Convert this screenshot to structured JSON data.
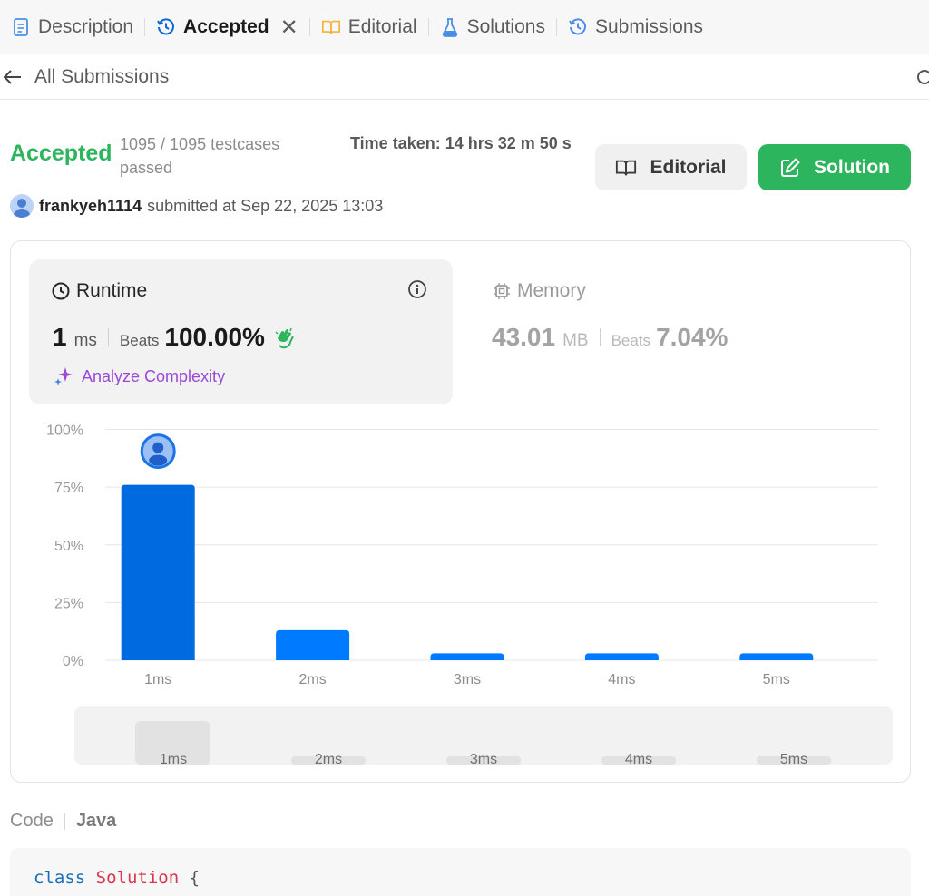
{
  "tabs": [
    {
      "label": "Description",
      "icon": "description-icon"
    },
    {
      "label": "Accepted",
      "icon": "history-icon",
      "active": true
    },
    {
      "label": "Editorial",
      "icon": "book-icon"
    },
    {
      "label": "Solutions",
      "icon": "flask-icon"
    },
    {
      "label": "Submissions",
      "icon": "history-icon"
    }
  ],
  "back": {
    "label": "All Submissions"
  },
  "result": {
    "status": "Accepted",
    "testcases": "1095 / 1095 testcases passed",
    "time_taken": "Time taken: 14 hrs 32 m 50 s",
    "user": "frankyeh1114",
    "submitted_at": "submitted at Sep 22, 2025 13:03"
  },
  "buttons": {
    "editorial": "Editorial",
    "solution": "Solution"
  },
  "runtime": {
    "title": "Runtime",
    "value": "1",
    "unit": "ms",
    "beats_label": "Beats",
    "beats": "100.00%",
    "analyze": "Analyze Complexity"
  },
  "memory": {
    "title": "Memory",
    "value": "43.01",
    "unit": "MB",
    "beats_label": "Beats",
    "beats": "7.04%"
  },
  "chart_data": {
    "type": "bar",
    "categories": [
      "1ms",
      "2ms",
      "3ms",
      "4ms",
      "5ms"
    ],
    "values": [
      76,
      13,
      3,
      3,
      3
    ],
    "ylim": [
      0,
      100
    ],
    "yticks": [
      "100%",
      "75%",
      "50%",
      "25%",
      "0%"
    ],
    "highlight_index": 0,
    "grid": true,
    "colors": {
      "highlight": "#006be0",
      "bar": "#007aff",
      "grid": "#e6e6e6"
    }
  },
  "navigator": {
    "labels": [
      "1ms",
      "2ms",
      "3ms",
      "4ms",
      "5ms"
    ]
  },
  "code": {
    "tab": "Code",
    "language": "Java",
    "line1_keyword": "class",
    "line1_name": "Solution",
    "line1_brace": "{"
  },
  "colors": {
    "accepted": "#2db55d",
    "accent": "#007aff",
    "analyze": "#9a48d8"
  }
}
